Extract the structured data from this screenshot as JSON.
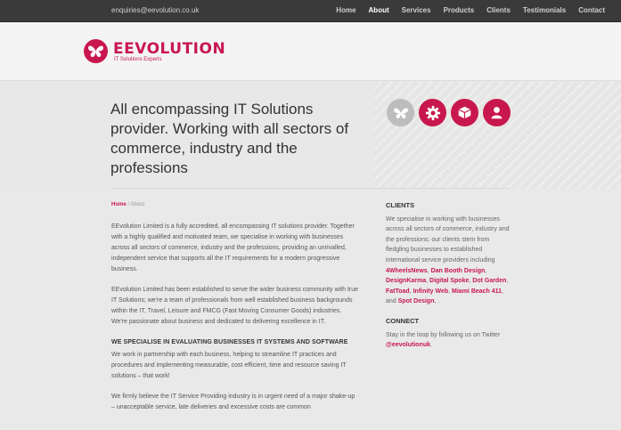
{
  "topbar": {
    "email": "enquiries@eevolution.co.uk",
    "nav": [
      "Home",
      "About",
      "Services",
      "Products",
      "Clients",
      "Testimonials",
      "Contact"
    ],
    "active": "About"
  },
  "logo": {
    "name": "EEVOLUTION",
    "tagline": "IT Solutions Experts"
  },
  "hero": {
    "title": "All encompassing IT Solutions provider. Working with all sectors of commerce, industry and the professions",
    "icons": [
      "butterfly-icon",
      "gear-icon",
      "box-icon",
      "user-icon"
    ]
  },
  "breadcrumb": {
    "home": "Home",
    "sep": "/",
    "current": "About"
  },
  "main": {
    "p1": "EEvolution Limited is a fully accredited, all encompassing IT solutions provider. Together with a highly qualified and motivated team, we specialise in working with businesses across all sectors of commerce, industry and the professions, providing an unrivalled, independent service that supports all the IT requirements for a modern progressive business.",
    "p2": "EEvolution Limited has been established to serve the wider business community with true IT Solutions; we're a team of professionals from well established business backgrounds within the IT, Travel, Leisure and FMCG (Fast Moving Consumer Goods) industries. We're passionate about business and dedicated to delivering excellence in IT.",
    "heading": "WE SPECIALISE IN EVALUATING BUSINESSES IT SYSTEMS AND SOFTWARE",
    "p3": "We work in partnership with each business, helping to streamline IT practices and procedures and implementing measurable, cost efficient, time and resource saving IT solutions – that work!",
    "p4": "We firmly believe the IT Service Providing industry is in urgent need of a major shake-up – unacceptable service, late deliveries and excessive costs are common"
  },
  "sidebar": {
    "clients_title": "CLIENTS",
    "clients_text": "We specialise in working with businesses across all sectors of commerce, industry and the professions; our clients stem from fledgling businesses to established international service providers including",
    "clients_links": [
      "4WheelsNews",
      "Dan Booth Design",
      "DesignKarma",
      "Digital Spoke",
      "Dot Garden",
      "FatToad",
      "Infinity Web",
      "Miami Beach 411",
      "Spot Design"
    ],
    "and_word": "and",
    "end": ".",
    "connect_title": "CONNECT",
    "connect_text": "Stay in the loop by following us on Twitter",
    "twitter": "@eevolutionuk",
    "twitter_end": "."
  },
  "colors": {
    "accent": "#c8174f",
    "topbar": "#3a3a3a"
  }
}
